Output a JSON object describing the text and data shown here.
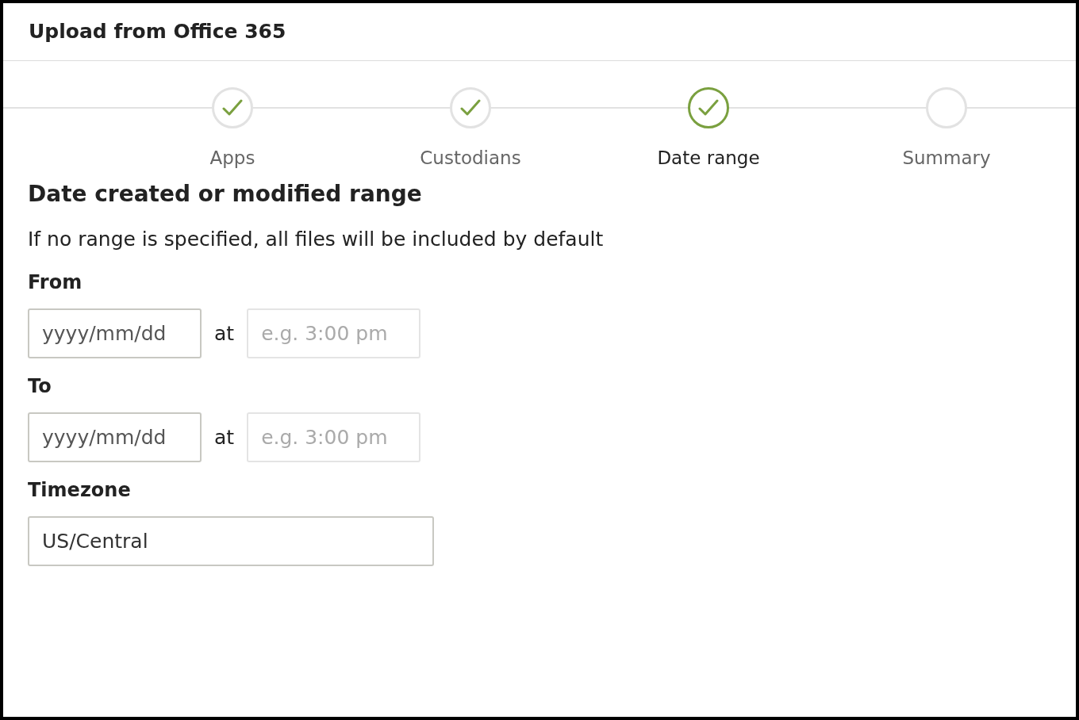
{
  "window": {
    "title": "Upload from Office 365"
  },
  "steps": [
    {
      "label": "Apps",
      "completed": true,
      "selected": false
    },
    {
      "label": "Custodians",
      "completed": true,
      "selected": false
    },
    {
      "label": "Date range",
      "completed": true,
      "selected": true
    },
    {
      "label": "Summary",
      "completed": false,
      "selected": false
    }
  ],
  "section": {
    "heading": "Date created or modified range",
    "description": "If no range is specified, all files will be included by default"
  },
  "ranges": [
    {
      "label": "From",
      "date_placeholder": "yyyy/mm/dd",
      "connector": "at",
      "time_placeholder": "e.g. 3:00 pm",
      "time_disabled": true
    },
    {
      "label": "To",
      "date_placeholder": "yyyy/mm/dd",
      "connector": "at",
      "time_placeholder": "e.g. 3:00 pm",
      "time_disabled": true
    }
  ],
  "timezone": {
    "label": "Timezone",
    "value": "US/Central"
  }
}
